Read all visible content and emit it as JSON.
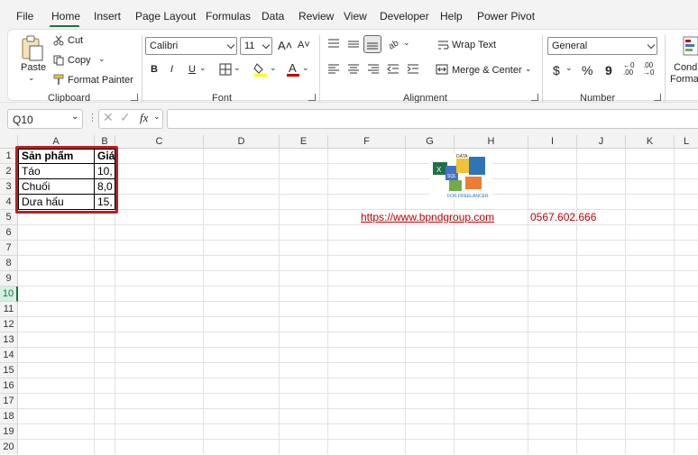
{
  "menu": {
    "tabs": [
      {
        "label": "File"
      },
      {
        "label": "Home"
      },
      {
        "label": "Insert"
      },
      {
        "label": "Page Layout"
      },
      {
        "label": "Formulas"
      },
      {
        "label": "Data"
      },
      {
        "label": "Review"
      },
      {
        "label": "View"
      },
      {
        "label": "Developer"
      },
      {
        "label": "Help"
      },
      {
        "label": "Power Pivot"
      }
    ],
    "active_index": 1
  },
  "ribbon": {
    "clipboard": {
      "paste": "Paste",
      "cut": "Cut",
      "copy": "Copy",
      "format_painter": "Format Painter",
      "label": "Clipboard"
    },
    "font": {
      "font_name": "Calibri",
      "font_size": "11",
      "bold": "B",
      "italic": "I",
      "underline": "U",
      "label": "Font"
    },
    "alignment": {
      "wrap_text": "Wrap Text",
      "merge_center": "Merge & Center",
      "label": "Alignment"
    },
    "number": {
      "format": "General",
      "currency": "$",
      "percent": "%",
      "comma": "9",
      "label": "Number"
    },
    "styles": {
      "conditional_1": "Condi",
      "conditional_2": "Format"
    }
  },
  "formula_bar": {
    "name_box": "Q10",
    "fx": "fx",
    "value": ""
  },
  "grid": {
    "columns": [
      "A",
      "B",
      "C",
      "D",
      "E",
      "F",
      "G",
      "H",
      "I",
      "J",
      "K",
      "L"
    ],
    "rows": [
      "1",
      "2",
      "3",
      "4",
      "5",
      "6",
      "7",
      "8",
      "9",
      "10",
      "11",
      "12",
      "13",
      "14",
      "15",
      "16",
      "17",
      "18",
      "19",
      "20"
    ],
    "selected_row": "10",
    "table": {
      "header": [
        "Sản phẩm",
        "Giá"
      ],
      "rows": [
        [
          "Táo",
          "10,"
        ],
        [
          "Chuối",
          "8,0"
        ],
        [
          "Dưa hấu",
          "15,"
        ]
      ]
    },
    "link": "https://www.bpndgroup.com",
    "phone": "0567.602.666",
    "logo_text": [
      "DATA",
      "SQL",
      "FOR FREELANCER"
    ]
  },
  "colors": {
    "accent": "#1e7145",
    "highlight_border": "#b22222",
    "link": "#c00000"
  }
}
